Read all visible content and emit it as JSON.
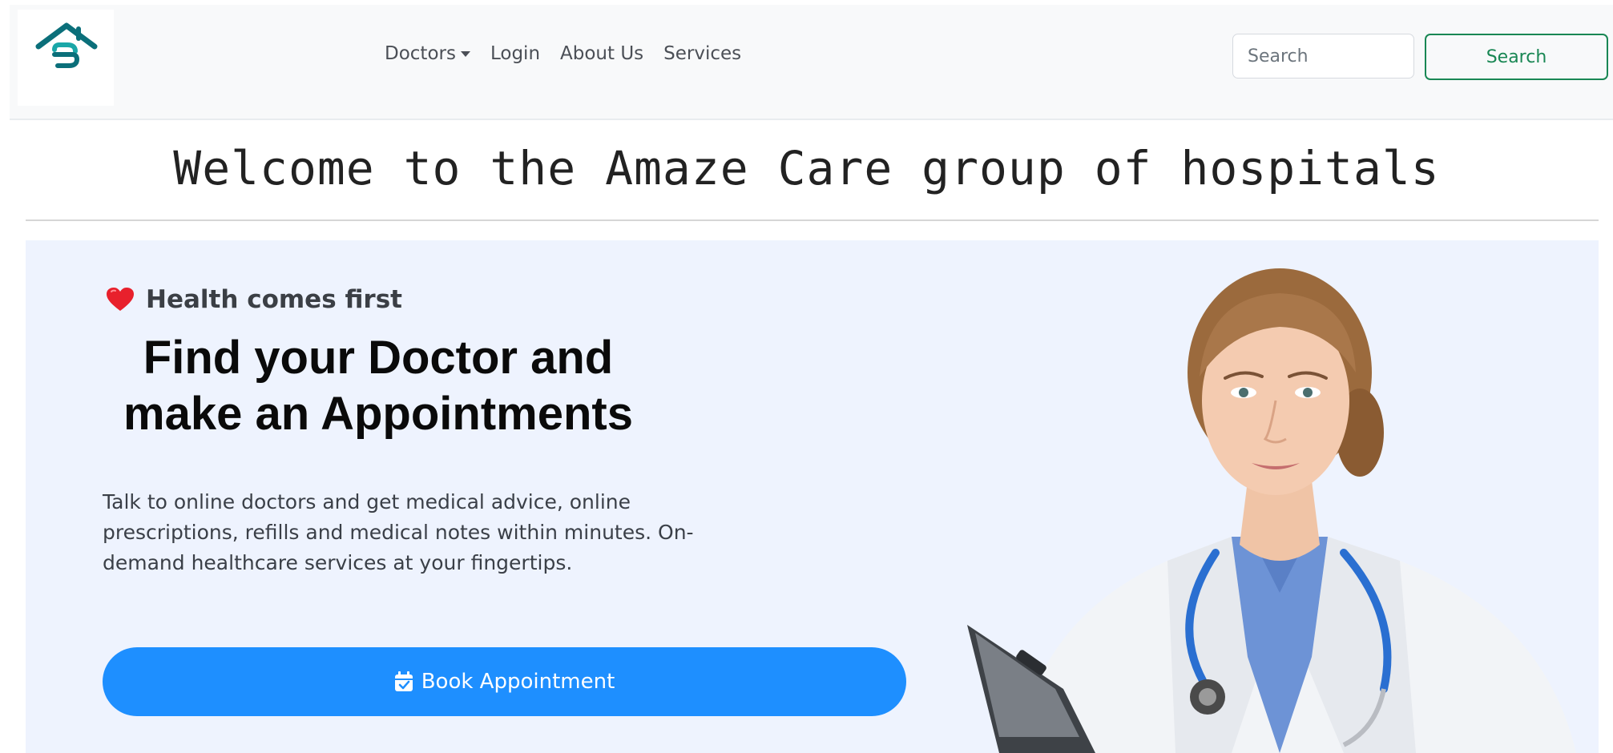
{
  "nav": {
    "logo_alt": "Amaze Care logo",
    "items": [
      {
        "label": "Doctors",
        "has_dropdown": true
      },
      {
        "label": "Login"
      },
      {
        "label": "About Us"
      },
      {
        "label": "Services"
      }
    ],
    "search": {
      "placeholder": "Search",
      "button_label": "Search"
    }
  },
  "welcome_title": "Welcome to the Amaze Care group of hospitals",
  "hero": {
    "tagline_icon": "heart-icon",
    "tagline": "Health comes first",
    "heading_line1": "Find your Doctor and",
    "heading_line2": "make an Appointments",
    "description": "Talk to online doctors and get medical advice, online prescriptions, refills and medical notes within minutes. On-demand healthcare services at your fingertips.",
    "cta_icon": "calendar-check-icon",
    "cta_label": "Book Appointment"
  },
  "colors": {
    "brand_teal": "#0b7d86",
    "search_green": "#198754",
    "cta_blue": "#1e8fff",
    "hero_bg": "#eef3fe"
  }
}
